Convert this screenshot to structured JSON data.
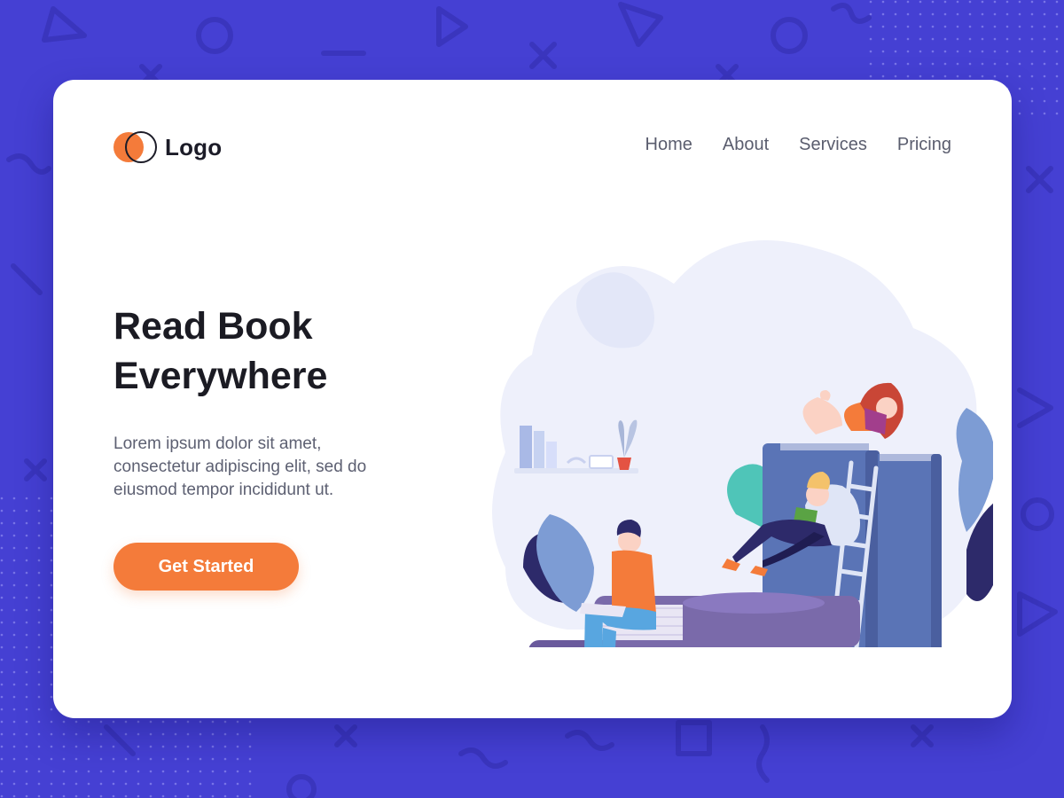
{
  "header": {
    "logo_text": "Logo",
    "logo_icon": "overlapping-circles-icon",
    "nav": [
      {
        "label": "Home"
      },
      {
        "label": "About"
      },
      {
        "label": "Services"
      },
      {
        "label": "Pricing"
      }
    ]
  },
  "hero": {
    "title_line1": "Read Book",
    "title_line2": "Everywhere",
    "description_line1": "Lorem ipsum dolor sit amet,",
    "description_line2": "consectetur adipiscing elit, sed do",
    "description_line3": "eiusmod tempor incididunt ut.",
    "cta_label": "Get Started"
  },
  "illustration": {
    "subject": "people-reading-on-giant-books-illustration"
  },
  "colors": {
    "background": "#4540d3",
    "card": "#ffffff",
    "accent": "#f47b3a",
    "title": "#1b1b23",
    "body_text": "#5d6072",
    "nav_text": "#5a5d6e",
    "book_purple": "#7a6aaa",
    "book_blue": "#5a74b6"
  }
}
